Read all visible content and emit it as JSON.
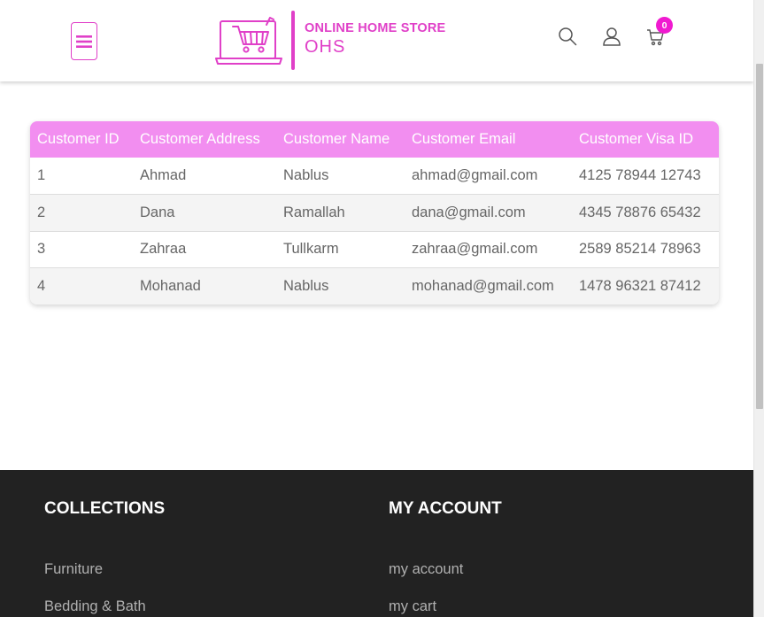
{
  "header": {
    "brand_name": "ONLINE HOME STORE",
    "brand_short": "OHS",
    "cart_count": "0",
    "icons": [
      "menu-icon",
      "search-icon",
      "user-icon",
      "cart-icon"
    ],
    "accent_color": "#e040c8"
  },
  "table": {
    "columns": [
      "Customer ID",
      "Customer Address",
      "Customer Name",
      "Customer Email",
      "Customer Visa ID"
    ],
    "rows": [
      [
        "1",
        "Ahmad",
        "Nablus",
        "ahmad@gmail.com",
        "4125 78944 12743"
      ],
      [
        "2",
        "Dana",
        "Ramallah",
        "dana@gmail.com",
        "4345 78876 65432"
      ],
      [
        "3",
        "Zahraa",
        "Tullkarm",
        "zahraa@gmail.com",
        "2589 85214 78963"
      ],
      [
        "4",
        "Mohanad",
        "Nablus",
        "mohanad@gmail.com",
        "1478 96321 87412"
      ]
    ],
    "header_color": "#f28ef0"
  },
  "footer": {
    "collections": {
      "title": "COLLECTIONS",
      "items": [
        "Furniture",
        "Bedding & Bath"
      ]
    },
    "account": {
      "title": "MY ACCOUNT",
      "items": [
        "my account",
        "my cart"
      ]
    },
    "background_color": "#222222"
  }
}
